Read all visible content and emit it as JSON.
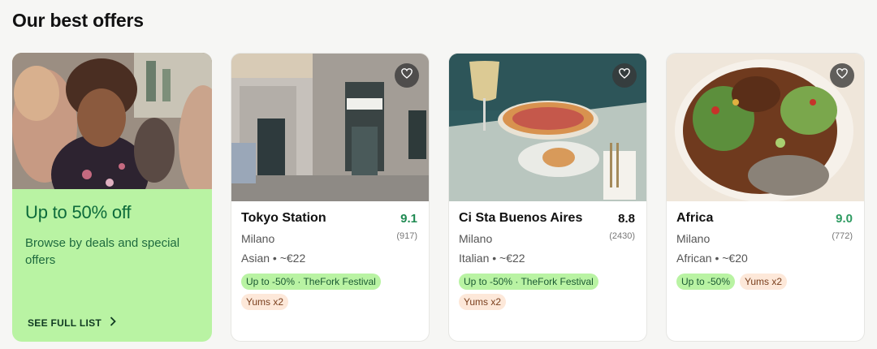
{
  "section": {
    "title": "Our best offers"
  },
  "promo": {
    "title": "Up to 50% off",
    "subtitle": "Browse by deals and special offers",
    "cta": "SEE FULL LIST"
  },
  "colors": {
    "promo_bg": "#b9f3a3",
    "rating_green": "#1f8a52",
    "tag_green_bg": "#b9f3a3",
    "tag_yums_bg": "#fde8d9"
  },
  "restaurants": [
    {
      "name": "Tokyo Station",
      "rating": "9.1",
      "rating_color": "#1f8a52",
      "reviews": "(917)",
      "city": "Milano",
      "cuisine": "Asian • ~€22",
      "tags": [
        "Up to -50% · TheFork Festival",
        "Yums x2"
      ]
    },
    {
      "name": "Ci Sta Buenos Aires",
      "rating": "8.8",
      "rating_color": "#111111",
      "reviews": "(2430)",
      "city": "Milano",
      "cuisine": "Italian • ~€22",
      "tags": [
        "Up to -50% · TheFork Festival",
        "Yums x2"
      ]
    },
    {
      "name": "Africa",
      "rating": "9.0",
      "rating_color": "#2f9b62",
      "reviews": "(772)",
      "city": "Milano",
      "cuisine": "African • ~€20",
      "tags": [
        "Up to -50%",
        "Yums x2"
      ]
    }
  ],
  "icons": {
    "favorite": "heart-icon",
    "cta_arrow": "chevron-right-icon"
  }
}
